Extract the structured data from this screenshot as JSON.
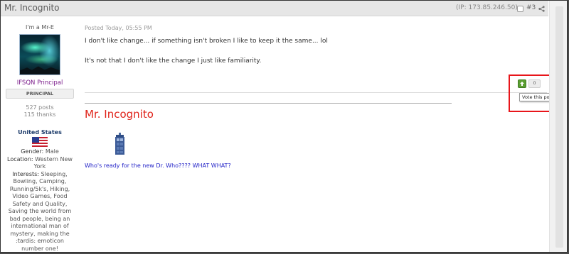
{
  "post": {
    "author_name": "Mr. Incognito",
    "ip_text": "(IP: 173.85.246.50)",
    "post_number": "#3",
    "posted_date": "Posted Today, 05:55 PM",
    "body_lines": [
      "I don't like change... if something isn't broken I like to keep it the same... lol",
      "It's not that I don't like the change I just like familiarity."
    ]
  },
  "author": {
    "member_title": "I'm a Mr-E",
    "group_name": "IFSQN Principal",
    "rank_badge": "PRINCIPAL",
    "posts_count": "527 posts",
    "thanks_count": "115 thanks",
    "country": "United States",
    "fields": [
      {
        "label": "Gender:",
        "value": "Male"
      },
      {
        "label": "Location:",
        "value": "Western New York"
      },
      {
        "label": "Interests:",
        "value": "Sleeping, Bowling, Camping, Running/5k's, Hiking, Video Games, Food Safety and Quality, Saving the world from bad people, being an international man of mystery, making the :tardis: emoticon number one!"
      }
    ]
  },
  "signature": {
    "name": "Mr. Incognito",
    "tagline": "Who's ready for the new Dr. Who????  WHAT WHAT?"
  },
  "vote": {
    "count": "0",
    "tooltip": "Vote this post up"
  },
  "icons": {
    "share": "share-icon",
    "checkbox": "select-post-checkbox",
    "vote_up": "thumb-up-arrow-icon",
    "flag": "us-flag-icon",
    "tardis": "tardis-emoticon-icon"
  },
  "colors": {
    "signature_name": "#e0241b",
    "group_name": "#7a1a8a",
    "vote_up": "#5b9e32",
    "highlight": "#e8151a",
    "link": "#2424c8"
  }
}
